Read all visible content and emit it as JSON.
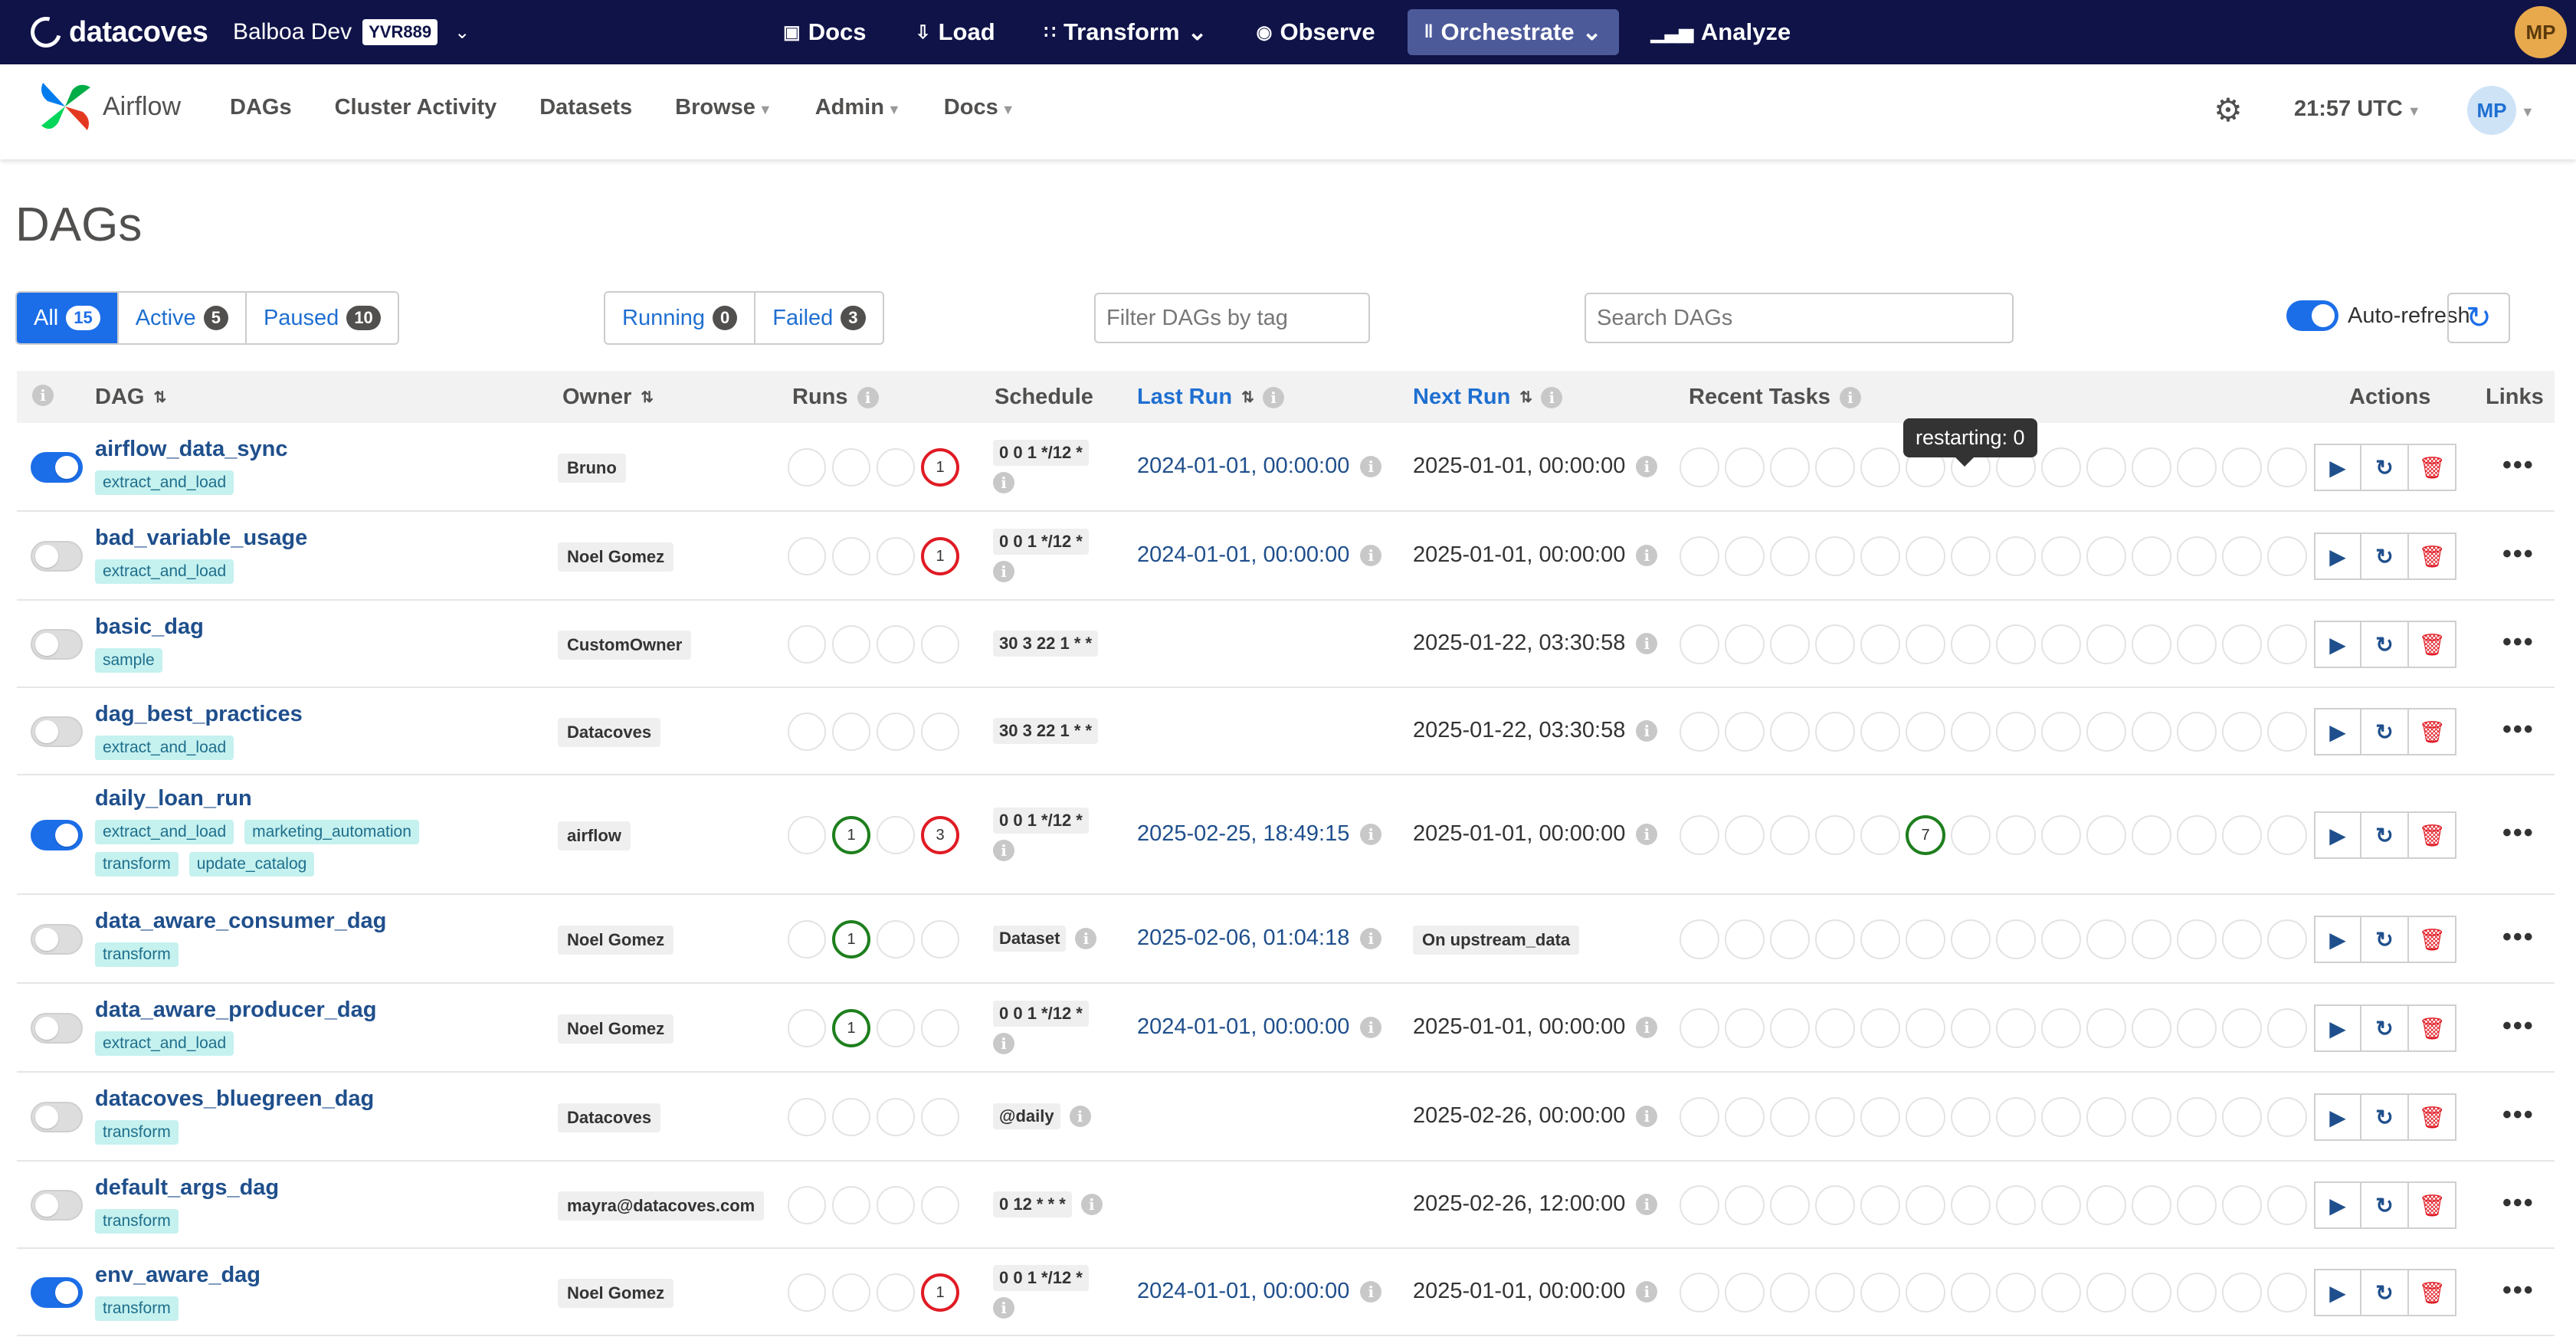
{
  "datacoves": {
    "brand": "datacoves",
    "environment": "Balboa Dev",
    "env_code": "YVR889",
    "nav": [
      {
        "label": "Docs",
        "icon": "book-icon"
      },
      {
        "label": "Load",
        "icon": "load-icon"
      },
      {
        "label": "Transform",
        "icon": "transform-icon",
        "dropdown": true
      },
      {
        "label": "Observe",
        "icon": "eye-icon"
      },
      {
        "label": "Orchestrate",
        "icon": "orchestrate-icon",
        "dropdown": true,
        "active": true
      },
      {
        "label": "Analyze",
        "icon": "bar-chart-icon"
      }
    ],
    "user_initials": "MP"
  },
  "airflow": {
    "brand": "Airflow",
    "menu": [
      "DAGs",
      "Cluster Activity",
      "Datasets",
      "Browse",
      "Admin",
      "Docs"
    ],
    "time": "21:57 UTC",
    "user_initials": "MP"
  },
  "page_title": "DAGs",
  "filters": {
    "status": [
      {
        "label": "All",
        "count": "15",
        "active": true
      },
      {
        "label": "Active",
        "count": "5"
      },
      {
        "label": "Paused",
        "count": "10"
      }
    ],
    "run_state": [
      {
        "label": "Running",
        "count": "0"
      },
      {
        "label": "Failed",
        "count": "3"
      }
    ],
    "tag_placeholder": "Filter DAGs by tag",
    "search_placeholder": "Search DAGs",
    "auto_refresh": "Auto-refresh"
  },
  "columns": {
    "dag": "DAG",
    "owner": "Owner",
    "runs": "Runs",
    "schedule": "Schedule",
    "last_run": "Last Run",
    "next_run": "Next Run",
    "recent_tasks": "Recent Tasks",
    "actions": "Actions",
    "links": "Links"
  },
  "tooltip": "restarting: 0",
  "dags": [
    {
      "name": "airflow_data_sync",
      "active": true,
      "tags": [
        "extract_and_load"
      ],
      "owner": "Bruno",
      "runs": [
        "",
        "",
        "",
        {
          "v": "1",
          "s": "red"
        }
      ],
      "schedule": "0 0 1 */12 *",
      "schedule_info": true,
      "last_run": "2024-01-01, 00:00:00",
      "next_run": "2025-01-01, 00:00:00",
      "next_pill": false,
      "recent": []
    },
    {
      "name": "bad_variable_usage",
      "active": false,
      "tags": [
        "extract_and_load"
      ],
      "owner": "Noel Gomez",
      "runs": [
        "",
        "",
        "",
        {
          "v": "1",
          "s": "red"
        }
      ],
      "schedule": "0 0 1 */12 *",
      "schedule_info": true,
      "last_run": "2024-01-01, 00:00:00",
      "next_run": "2025-01-01, 00:00:00",
      "next_pill": false,
      "recent": []
    },
    {
      "name": "basic_dag",
      "active": false,
      "tags": [
        "sample"
      ],
      "owner": "CustomOwner",
      "runs": [
        "",
        "",
        "",
        ""
      ],
      "schedule": "30 3 22 1 * *",
      "schedule_info": false,
      "last_run": "",
      "next_run": "2025-01-22, 03:30:58",
      "next_pill": false,
      "recent": []
    },
    {
      "name": "dag_best_practices",
      "active": false,
      "tags": [
        "extract_and_load"
      ],
      "owner": "Datacoves",
      "runs": [
        "",
        "",
        "",
        ""
      ],
      "schedule": "30 3 22 1 * *",
      "schedule_info": false,
      "last_run": "",
      "next_run": "2025-01-22, 03:30:58",
      "next_pill": false,
      "recent": []
    },
    {
      "name": "daily_loan_run",
      "active": true,
      "tags": [
        "extract_and_load",
        "marketing_automation",
        "transform",
        "update_catalog"
      ],
      "owner": "airflow",
      "runs": [
        "",
        {
          "v": "1",
          "s": "green"
        },
        "",
        {
          "v": "3",
          "s": "red"
        }
      ],
      "schedule": "0 0 1 */12 *",
      "schedule_info": true,
      "last_run": "2025-02-25, 18:49:15",
      "next_run": "2025-01-01, 00:00:00",
      "next_pill": false,
      "recent": [
        {
          "idx": 5,
          "v": "7",
          "s": "green"
        }
      ]
    },
    {
      "name": "data_aware_consumer_dag",
      "active": false,
      "tags": [
        "transform"
      ],
      "owner": "Noel Gomez",
      "runs": [
        "",
        {
          "v": "1",
          "s": "green"
        },
        "",
        ""
      ],
      "schedule": "Dataset",
      "schedule_info": true,
      "schedule_inline": true,
      "last_run": "2025-02-06, 01:04:18",
      "next_run": "On upstream_data",
      "next_pill": true,
      "recent": []
    },
    {
      "name": "data_aware_producer_dag",
      "active": false,
      "tags": [
        "extract_and_load"
      ],
      "owner": "Noel Gomez",
      "runs": [
        "",
        {
          "v": "1",
          "s": "green"
        },
        "",
        ""
      ],
      "schedule": "0 0 1 */12 *",
      "schedule_info": true,
      "last_run": "2024-01-01, 00:00:00",
      "next_run": "2025-01-01, 00:00:00",
      "next_pill": false,
      "recent": []
    },
    {
      "name": "datacoves_bluegreen_dag",
      "active": false,
      "tags": [
        "transform"
      ],
      "owner": "Datacoves",
      "runs": [
        "",
        "",
        "",
        ""
      ],
      "schedule": "@daily",
      "schedule_info": true,
      "schedule_inline": true,
      "last_run": "",
      "next_run": "2025-02-26, 00:00:00",
      "next_pill": false,
      "recent": []
    },
    {
      "name": "default_args_dag",
      "active": false,
      "tags": [
        "transform"
      ],
      "owner": "mayra@datacoves.com",
      "runs": [
        "",
        "",
        "",
        ""
      ],
      "schedule": "0 12 * * *",
      "schedule_info": true,
      "schedule_inline": true,
      "last_run": "",
      "next_run": "2025-02-26, 12:00:00",
      "next_pill": false,
      "recent": []
    },
    {
      "name": "env_aware_dag",
      "active": true,
      "tags": [
        "transform"
      ],
      "owner": "Noel Gomez",
      "runs": [
        "",
        "",
        "",
        {
          "v": "1",
          "s": "red"
        }
      ],
      "schedule": "0 0 1 */12 *",
      "schedule_info": true,
      "last_run": "2024-01-01, 00:00:00",
      "next_run": "2025-01-01, 00:00:00",
      "next_pill": false,
      "recent": []
    }
  ]
}
